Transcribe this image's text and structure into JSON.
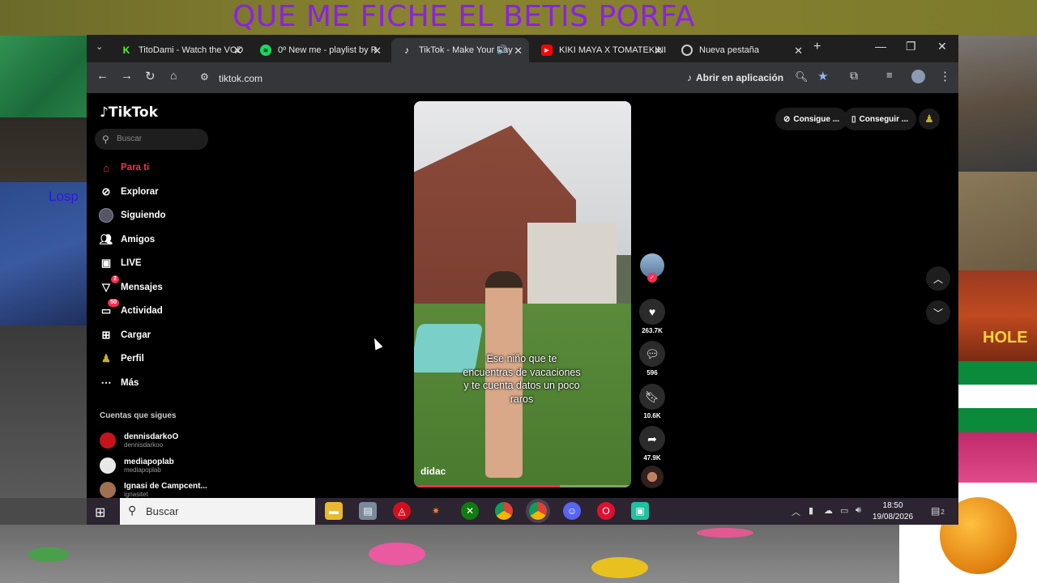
{
  "overlay": {
    "title": "QUE ME FICHE EL BETIS  PORFA",
    "side_text": "Losp"
  },
  "tabs": [
    {
      "title": "TitoDami - Watch the VOD",
      "favicon": "kick-icon",
      "color": "#53fc18"
    },
    {
      "title": "0º New me - playlist by R",
      "favicon": "spotify-icon",
      "color": "#1ed760"
    },
    {
      "title": "TikTok - Make Your Day",
      "favicon": "tiktok-icon",
      "color": "#ffffff"
    },
    {
      "title": "KIKI MAYA X TOMATEKINI",
      "favicon": "youtube-icon",
      "color": "#ff0000"
    },
    {
      "title": "Nueva pestaña",
      "favicon": "chrome-icon",
      "color": "#cccccc"
    }
  ],
  "browser": {
    "url": "tiktok.com",
    "open_in_app": "Abrir en aplicación"
  },
  "tiktok": {
    "logo": "TikTok",
    "search_placeholder": "Buscar",
    "nav": [
      {
        "label": "Para ti",
        "icon": "home-icon",
        "active": true
      },
      {
        "label": "Explorar",
        "icon": "compass-icon"
      },
      {
        "label": "Siguiendo",
        "icon": "following-avatar-icon"
      },
      {
        "label": "Amigos",
        "icon": "friends-icon"
      },
      {
        "label": "LIVE",
        "icon": "live-icon"
      },
      {
        "label": "Mensajes",
        "icon": "messages-icon",
        "badge": "2"
      },
      {
        "label": "Actividad",
        "icon": "activity-icon",
        "badge": "50"
      },
      {
        "label": "Cargar",
        "icon": "upload-icon"
      },
      {
        "label": "Perfil",
        "icon": "profile-icon"
      },
      {
        "label": "Más",
        "icon": "more-icon"
      }
    ],
    "following_heading": "Cuentas que sigues",
    "accounts": [
      {
        "name": "dennisdarkoO",
        "handle": "dennisdarkoo",
        "color": "#c4141a"
      },
      {
        "name": "mediapoplab",
        "handle": "mediapoplab",
        "color": "#e8e8e8"
      },
      {
        "name": "Ignasi de Campcent...",
        "handle": "ignasitet",
        "color": "#a07050"
      }
    ],
    "top_buttons": [
      "Consigue ...",
      "Conseguir ..."
    ],
    "video": {
      "caption": "Ese niño que te encuentras de vacaciones y te cuenta datos un poco raros",
      "author": "didac",
      "progress": 0.67
    },
    "actions": [
      {
        "icon": "heart-icon",
        "count": "263.7K"
      },
      {
        "icon": "comment-icon",
        "count": "596"
      },
      {
        "icon": "bookmark-icon",
        "count": "10.6K"
      },
      {
        "icon": "share-icon",
        "count": "47.9K"
      }
    ]
  },
  "taskbar": {
    "search_placeholder": "Buscar",
    "time": "18:50",
    "date": "19/08/2026",
    "notifications": "2"
  }
}
